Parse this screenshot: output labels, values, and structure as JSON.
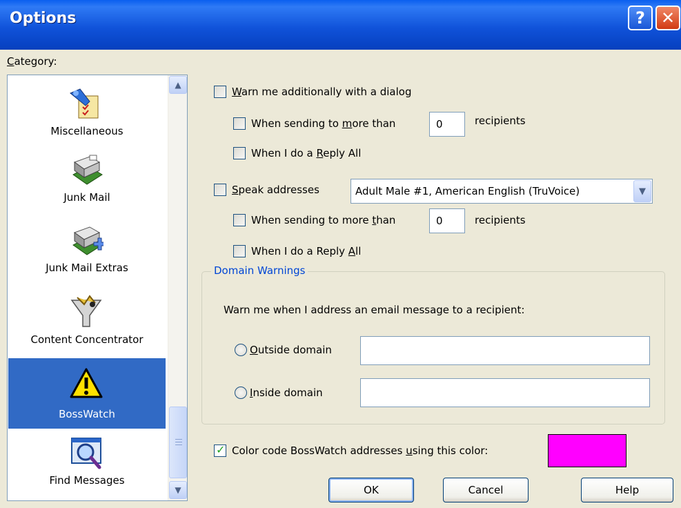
{
  "window": {
    "title": "Options",
    "help_glyph": "?",
    "close_glyph": "✕"
  },
  "category": {
    "label_prefix": "C",
    "label_rest": "ategory:",
    "items": [
      {
        "label": "Miscellaneous",
        "icon": "miscellaneous-icon"
      },
      {
        "label": "Junk Mail",
        "icon": "junk-mail-icon"
      },
      {
        "label": "Junk Mail Extras",
        "icon": "junk-mail-extras-icon"
      },
      {
        "label": "Content Concentrator",
        "icon": "funnel-icon"
      },
      {
        "label": "BossWatch",
        "icon": "warning-icon",
        "selected": true
      },
      {
        "label": "Find Messages",
        "icon": "magnifier-icon"
      }
    ],
    "scroll_up": "▲",
    "scroll_down": "▼"
  },
  "warn": {
    "checked": false,
    "label_pre": "",
    "label_key": "W",
    "label_post": "arn me additionally with a dialog",
    "more_than": {
      "checked": false,
      "pre": "When sending to ",
      "key": "m",
      "post": "ore than",
      "value": "0",
      "suffix": "recipients"
    },
    "reply_all": {
      "checked": false,
      "pre": "When I do a ",
      "key": "R",
      "post": "eply All"
    }
  },
  "speak": {
    "checked": false,
    "label_key": "S",
    "label_post": "peak addresses",
    "voice": "Adult Male #1, American English (TruVoice)",
    "more_than": {
      "checked": false,
      "pre": "When sending to more ",
      "key": "t",
      "post": "han",
      "value": "0",
      "suffix": "recipients"
    },
    "reply_all": {
      "checked": false,
      "pre": "When I do a Reply ",
      "key": "A",
      "post": "ll"
    }
  },
  "domain": {
    "title": "Domain Warnings",
    "prompt": "Warn me when I address an email message to a recipient:",
    "outside": {
      "key": "O",
      "post": "utside domain",
      "value": ""
    },
    "inside": {
      "key": "I",
      "post": "nside domain",
      "value": ""
    }
  },
  "color_code": {
    "checked": true,
    "pre": "Color code BossWatch addresses ",
    "key": "u",
    "post": "sing this color:",
    "color": "#FF00FF"
  },
  "buttons": {
    "ok": "OK",
    "cancel": "Cancel",
    "help": "Help"
  },
  "colors": {
    "title_bar": "#0A5FEF",
    "selection": "#316AC5",
    "group_title": "#0046D5",
    "dialog_bg": "#ECE9D8"
  }
}
